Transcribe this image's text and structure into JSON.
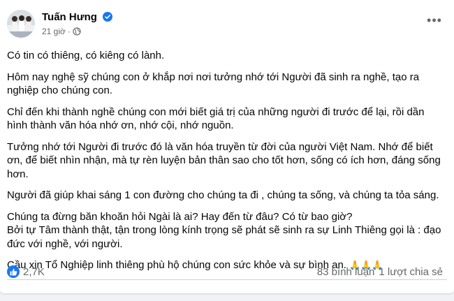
{
  "post": {
    "author": "Tuấn Hưng",
    "time": "21 giờ",
    "separator": "·",
    "paragraphs": [
      "Có tin có thiêng, có kiêng có lành.",
      "Hôm nay nghệ sỹ chúng con ở khắp nơi nơi tưởng nhớ tới Người đã sinh ra nghề, tạo ra nghiệp cho chúng con.",
      "Chỉ đến khi thành nghề chúng con mới biết giá trị của những người đi trước để lại, rồi dần hình thành văn hóa nhớ ơn, nhớ cội, nhớ nguồn.",
      "Tưởng nhớ tới Người đi trước đó là văn hóa truyền từ đời của người Việt Nam. Nhớ để biết ơn, để biết nhìn nhận, mà tự rèn luyện bản thân sao cho tốt hơn, sống có ích hơn, đáng sống hơn.",
      "Người đã giúp khai sáng 1 con đường cho chúng ta đi , chúng ta sống, và chúng ta tỏa sáng.",
      "Chúng ta đừng băn khoăn hỏi Ngài là ai? Hay đến từ đâu? Có từ bao giờ?",
      "Bởi tự  Tâm thành thật, tận trong lòng kính trọng sẽ phát sẽ  sinh ra sự Linh Thiêng  gọi là : đạo đức với nghề, với người.",
      "Cầu xin Tổ Nghiệp linh thiêng phù hộ chúng con sức khỏe và sự bình an."
    ],
    "emoji": "🙏🙏🙏"
  },
  "footer": {
    "reactions": "2,7K",
    "comments": "83 bình luận",
    "shares": "1 lượt chia sẻ"
  },
  "colors": {
    "accent": "#1877f2",
    "secondary_text": "#65676b",
    "emoji": "#f5b63d"
  },
  "icons": {
    "verified": "verified-badge-icon",
    "audience": "globe-icon",
    "more": "more-options-icon",
    "like": "like-icon"
  }
}
